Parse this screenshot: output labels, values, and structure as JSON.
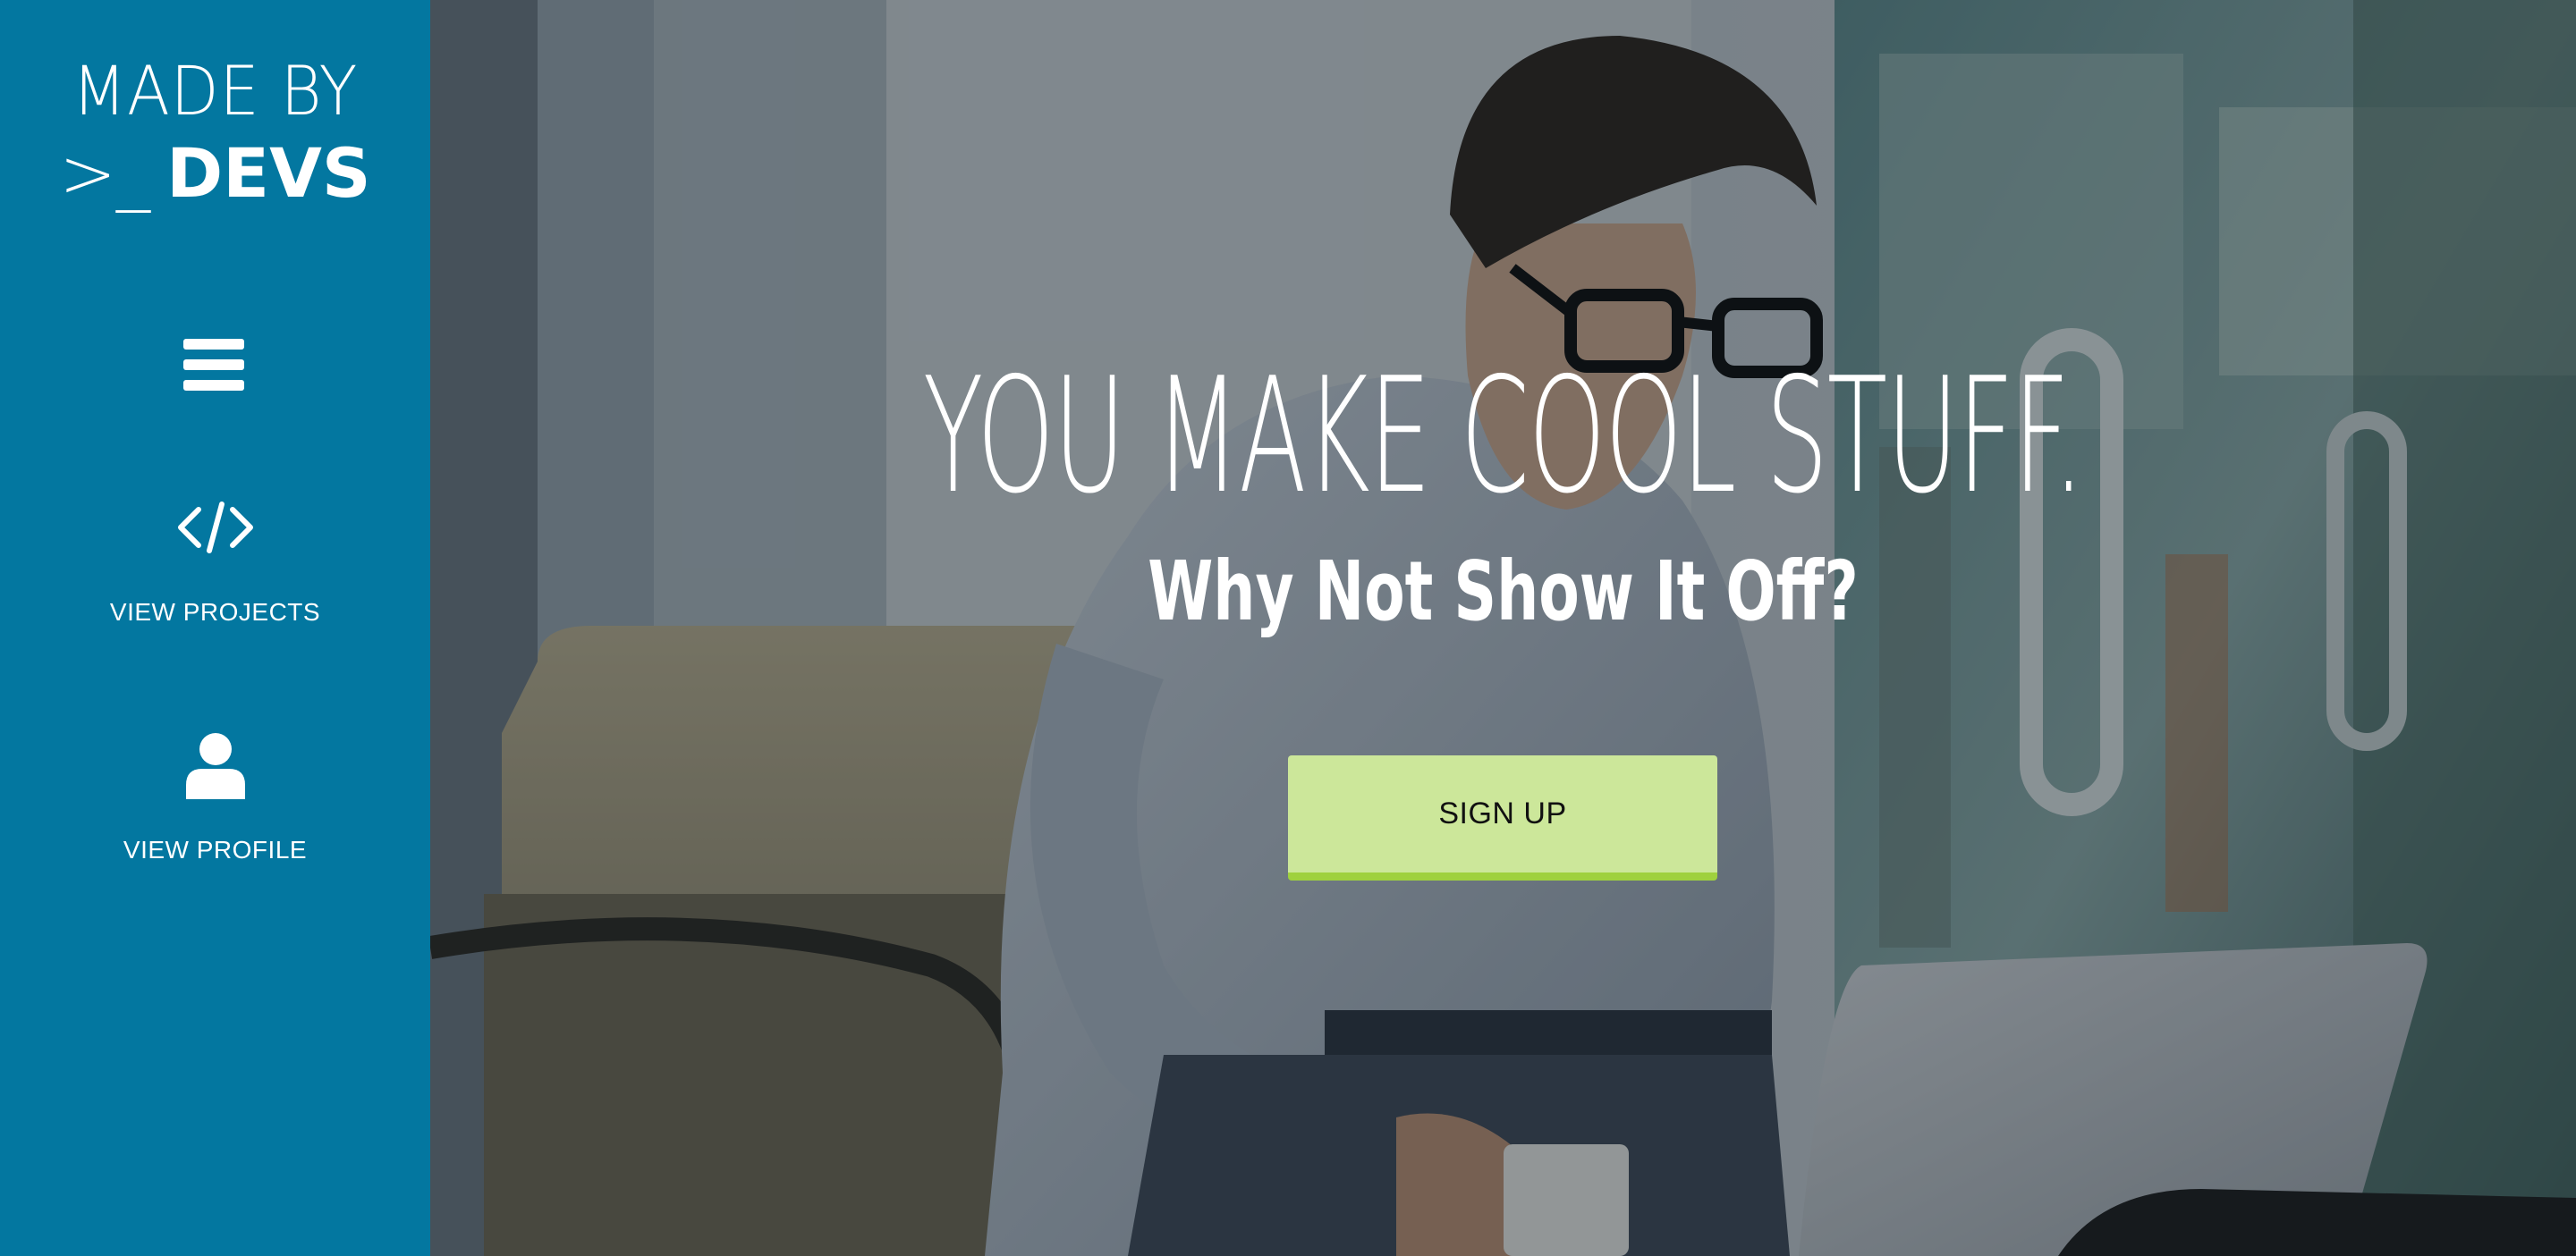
{
  "sidebar": {
    "logo": {
      "line1": "MADE BY",
      "prompt": ">_",
      "brand": "DEVS"
    },
    "menu_icon": "hamburger-icon",
    "nav": [
      {
        "icon": "code-icon",
        "label": "VIEW PROJECTS"
      },
      {
        "icon": "user-icon",
        "label": "VIEW PROFILE"
      }
    ],
    "background_color": "#0377a0"
  },
  "hero": {
    "headline": "YOU MAKE COOL STUFF.",
    "subheadline": "Why Not Show It Off?",
    "cta": {
      "label": "SIGN UP",
      "color": "#cce79a",
      "border_color": "#9fd13e"
    },
    "background_image": "man with glasses working on laptop in office lounge"
  }
}
